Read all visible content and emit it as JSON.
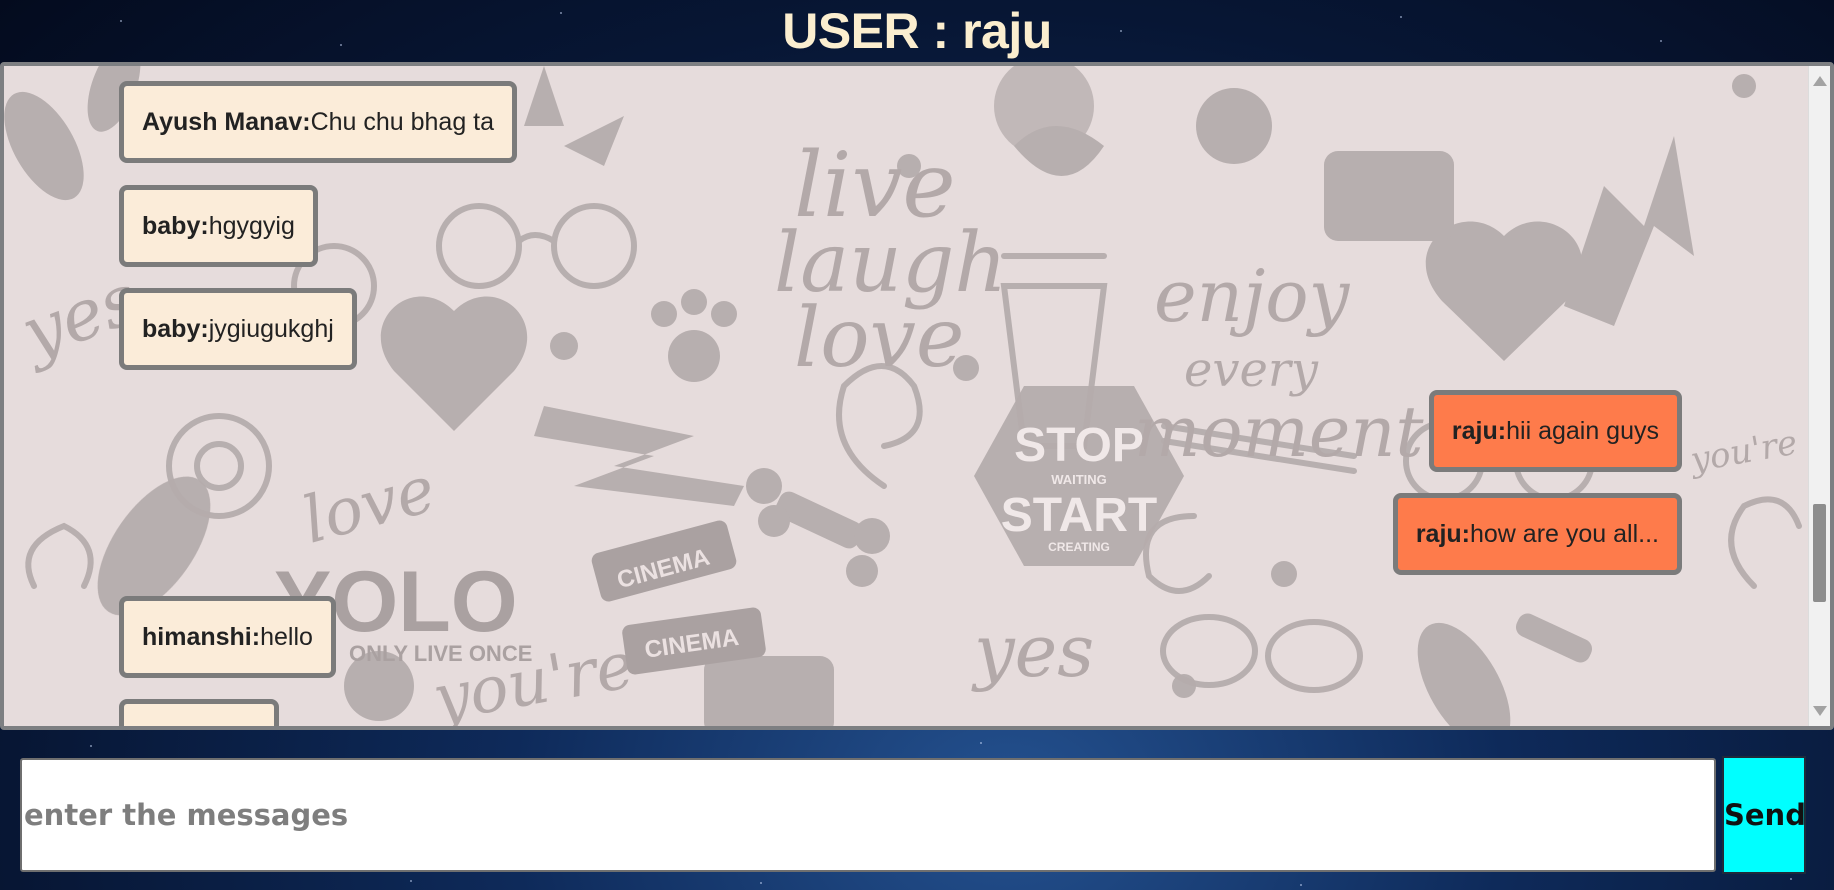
{
  "header": {
    "title": "USER : raju"
  },
  "messages": [
    {
      "sender": "Ayush Manav:",
      "text": "Chu chu bhag ta",
      "direction": "incoming"
    },
    {
      "sender": "baby:",
      "text": "hgygyig",
      "direction": "incoming"
    },
    {
      "sender": "baby:",
      "text": "jygiugukghj",
      "direction": "incoming"
    },
    {
      "sender": "raju:",
      "text": "hii again guys",
      "direction": "outgoing"
    },
    {
      "sender": "raju:",
      "text": "how are you all...",
      "direction": "outgoing"
    },
    {
      "sender": "himanshi:",
      "text": "hello",
      "direction": "incoming"
    }
  ],
  "background_art": {
    "phrases": [
      "live",
      "laugh",
      "love",
      "enjoy",
      "every",
      "moment.",
      "STOP",
      "WAITING",
      "START",
      "CREATING",
      "YOLO",
      "ONLY LIVE ONCE",
      "CINEMA",
      "CINEMA",
      "yes",
      "yes",
      "love",
      "you're",
      "you're amazing"
    ]
  },
  "composer": {
    "placeholder": "enter the messages",
    "value": ""
  },
  "send_button": {
    "label": "Send"
  },
  "colors": {
    "incoming_bubble": "#fbecd9",
    "outgoing_bubble": "#fe7b4b",
    "send_button": "#00ffff",
    "title_text": "#fbeecf"
  }
}
